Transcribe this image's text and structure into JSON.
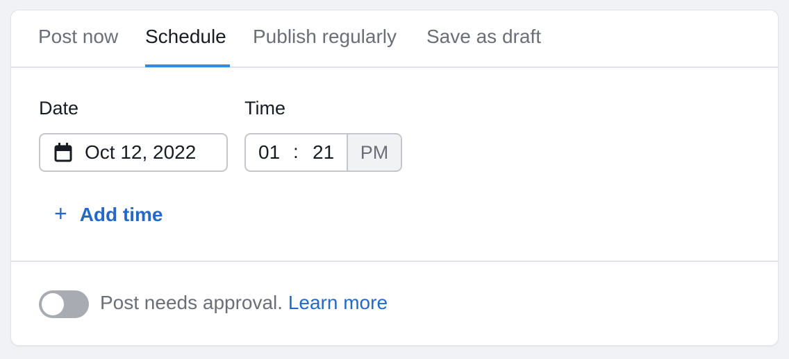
{
  "tabs": [
    {
      "label": "Post now",
      "active": false
    },
    {
      "label": "Schedule",
      "active": true
    },
    {
      "label": "Publish regularly",
      "active": false
    },
    {
      "label": "Save as draft",
      "active": false
    }
  ],
  "form": {
    "date_label": "Date",
    "date_value": "Oct 12, 2022",
    "date_icon": "calendar-icon",
    "time_label": "Time",
    "time_hour": "01",
    "time_separator": ":",
    "time_minute": "21",
    "time_period": "PM",
    "add_time_icon": "plus-icon",
    "add_time_label": "Add time"
  },
  "approval": {
    "toggle_on": false,
    "text": "Post needs approval.",
    "link": "Learn more"
  },
  "colors": {
    "accent": "#2b8be6",
    "link": "#2469c7",
    "toggle_off": "#a9abb2"
  }
}
